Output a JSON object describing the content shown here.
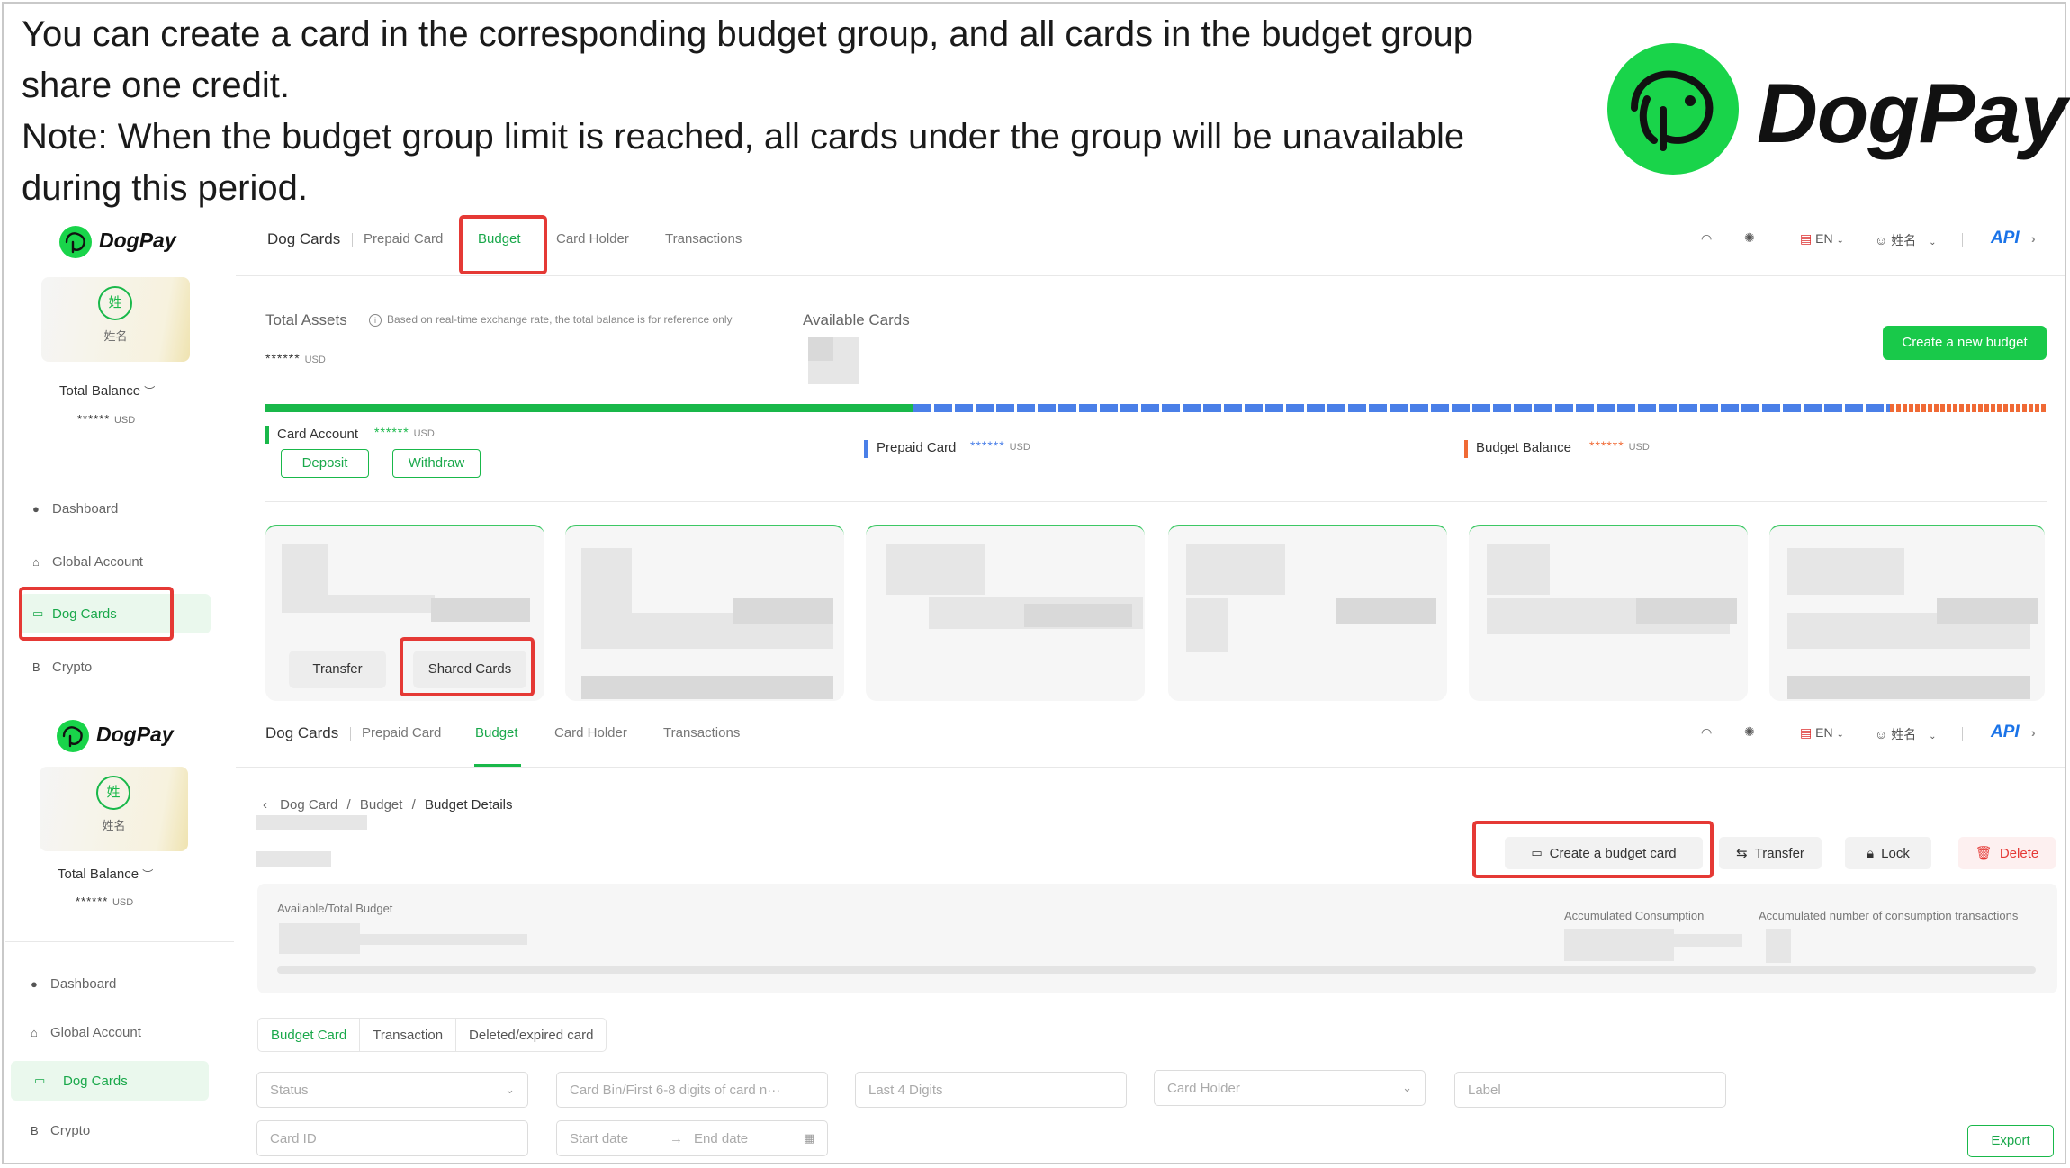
{
  "intro": {
    "line1": "You can create a card in the corresponding budget group, and all cards in the budget group",
    "line2": "share one credit.",
    "line3": "Note:  When the budget group limit is reached, all cards under the group will be unavailable",
    "line4": "during this period."
  },
  "brand": {
    "name": "DogPay"
  },
  "sidebar": {
    "avatar_char": "姓",
    "user_name": "姓名",
    "total_balance_label": "Total Balance",
    "total_balance_value": "******",
    "currency": "USD",
    "items": [
      {
        "label": "Dashboard",
        "icon": "dashboard-icon"
      },
      {
        "label": "Global Account",
        "icon": "bank-icon"
      },
      {
        "label": "Dog Cards",
        "icon": "card-icon"
      },
      {
        "label": "Crypto",
        "icon": "bitcoin-icon"
      }
    ]
  },
  "topnav": {
    "tabs": [
      "Dog Cards",
      "Prepaid Card",
      "Budget",
      "Card Holder",
      "Transactions"
    ],
    "lang": "EN",
    "user": "姓名",
    "api": "API"
  },
  "assets": {
    "total_assets_label": "Total Assets",
    "hint": "Based on real-time exchange rate, the total balance is for reference only",
    "total_value": "******",
    "currency": "USD",
    "available_cards_label": "Available Cards",
    "create_budget_label": "Create a new budget",
    "card_account_label": "Card Account",
    "card_account_value": "******",
    "prepaid_card_label": "Prepaid Card",
    "prepaid_card_value": "******",
    "budget_balance_label": "Budget Balance",
    "budget_balance_value": "******",
    "deposit_label": "Deposit",
    "withdraw_label": "Withdraw",
    "colors": {
      "card_account": "#19b84a",
      "prepaid": "#4a7fe8",
      "budget": "#f06a35"
    }
  },
  "budget_card": {
    "transfer_label": "Transfer",
    "shared_cards_label": "Shared Cards"
  },
  "details": {
    "breadcrumb": [
      "Dog Card",
      "Budget",
      "Budget Details"
    ],
    "actions": {
      "create_card": "Create a budget card",
      "transfer": "Transfer",
      "lock": "Lock",
      "delete": "Delete"
    },
    "available_total_label": "Available/Total Budget",
    "accumulated_consumption_label": "Accumulated Consumption",
    "accumulated_transactions_label": "Accumulated number of consumption transactions",
    "tabs": [
      "Budget Card",
      "Transaction",
      "Deleted/expired card"
    ],
    "filters": {
      "status": "Status",
      "card_bin": "Card Bin/First 6-8 digits of card n···",
      "last4": "Last 4 Digits",
      "card_holder": "Card Holder",
      "label": "Label",
      "card_id": "Card ID",
      "start_date": "Start date",
      "end_date": "End date"
    },
    "export_label": "Export"
  }
}
